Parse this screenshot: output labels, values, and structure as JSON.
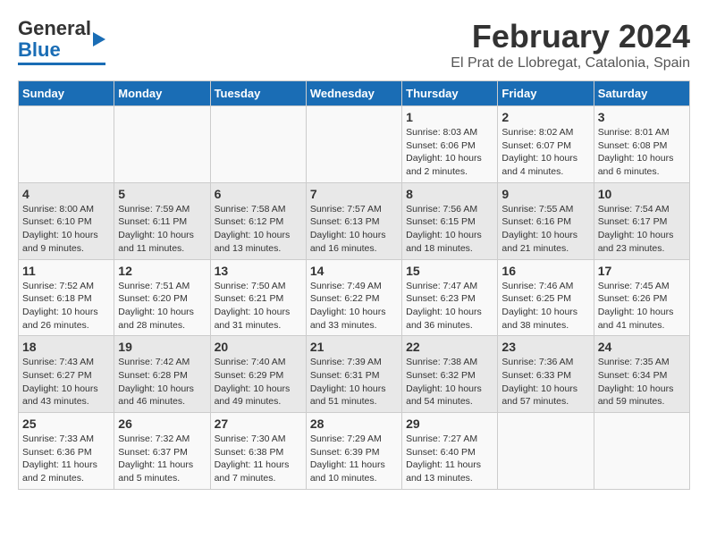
{
  "header": {
    "logo_general": "General",
    "logo_blue": "Blue",
    "title": "February 2024",
    "subtitle": "El Prat de Llobregat, Catalonia, Spain"
  },
  "weekdays": [
    "Sunday",
    "Monday",
    "Tuesday",
    "Wednesday",
    "Thursday",
    "Friday",
    "Saturday"
  ],
  "weeks": [
    [
      {
        "day": "",
        "info": ""
      },
      {
        "day": "",
        "info": ""
      },
      {
        "day": "",
        "info": ""
      },
      {
        "day": "",
        "info": ""
      },
      {
        "day": "1",
        "info": "Sunrise: 8:03 AM\nSunset: 6:06 PM\nDaylight: 10 hours\nand 2 minutes."
      },
      {
        "day": "2",
        "info": "Sunrise: 8:02 AM\nSunset: 6:07 PM\nDaylight: 10 hours\nand 4 minutes."
      },
      {
        "day": "3",
        "info": "Sunrise: 8:01 AM\nSunset: 6:08 PM\nDaylight: 10 hours\nand 6 minutes."
      }
    ],
    [
      {
        "day": "4",
        "info": "Sunrise: 8:00 AM\nSunset: 6:10 PM\nDaylight: 10 hours\nand 9 minutes."
      },
      {
        "day": "5",
        "info": "Sunrise: 7:59 AM\nSunset: 6:11 PM\nDaylight: 10 hours\nand 11 minutes."
      },
      {
        "day": "6",
        "info": "Sunrise: 7:58 AM\nSunset: 6:12 PM\nDaylight: 10 hours\nand 13 minutes."
      },
      {
        "day": "7",
        "info": "Sunrise: 7:57 AM\nSunset: 6:13 PM\nDaylight: 10 hours\nand 16 minutes."
      },
      {
        "day": "8",
        "info": "Sunrise: 7:56 AM\nSunset: 6:15 PM\nDaylight: 10 hours\nand 18 minutes."
      },
      {
        "day": "9",
        "info": "Sunrise: 7:55 AM\nSunset: 6:16 PM\nDaylight: 10 hours\nand 21 minutes."
      },
      {
        "day": "10",
        "info": "Sunrise: 7:54 AM\nSunset: 6:17 PM\nDaylight: 10 hours\nand 23 minutes."
      }
    ],
    [
      {
        "day": "11",
        "info": "Sunrise: 7:52 AM\nSunset: 6:18 PM\nDaylight: 10 hours\nand 26 minutes."
      },
      {
        "day": "12",
        "info": "Sunrise: 7:51 AM\nSunset: 6:20 PM\nDaylight: 10 hours\nand 28 minutes."
      },
      {
        "day": "13",
        "info": "Sunrise: 7:50 AM\nSunset: 6:21 PM\nDaylight: 10 hours\nand 31 minutes."
      },
      {
        "day": "14",
        "info": "Sunrise: 7:49 AM\nSunset: 6:22 PM\nDaylight: 10 hours\nand 33 minutes."
      },
      {
        "day": "15",
        "info": "Sunrise: 7:47 AM\nSunset: 6:23 PM\nDaylight: 10 hours\nand 36 minutes."
      },
      {
        "day": "16",
        "info": "Sunrise: 7:46 AM\nSunset: 6:25 PM\nDaylight: 10 hours\nand 38 minutes."
      },
      {
        "day": "17",
        "info": "Sunrise: 7:45 AM\nSunset: 6:26 PM\nDaylight: 10 hours\nand 41 minutes."
      }
    ],
    [
      {
        "day": "18",
        "info": "Sunrise: 7:43 AM\nSunset: 6:27 PM\nDaylight: 10 hours\nand 43 minutes."
      },
      {
        "day": "19",
        "info": "Sunrise: 7:42 AM\nSunset: 6:28 PM\nDaylight: 10 hours\nand 46 minutes."
      },
      {
        "day": "20",
        "info": "Sunrise: 7:40 AM\nSunset: 6:29 PM\nDaylight: 10 hours\nand 49 minutes."
      },
      {
        "day": "21",
        "info": "Sunrise: 7:39 AM\nSunset: 6:31 PM\nDaylight: 10 hours\nand 51 minutes."
      },
      {
        "day": "22",
        "info": "Sunrise: 7:38 AM\nSunset: 6:32 PM\nDaylight: 10 hours\nand 54 minutes."
      },
      {
        "day": "23",
        "info": "Sunrise: 7:36 AM\nSunset: 6:33 PM\nDaylight: 10 hours\nand 57 minutes."
      },
      {
        "day": "24",
        "info": "Sunrise: 7:35 AM\nSunset: 6:34 PM\nDaylight: 10 hours\nand 59 minutes."
      }
    ],
    [
      {
        "day": "25",
        "info": "Sunrise: 7:33 AM\nSunset: 6:36 PM\nDaylight: 11 hours\nand 2 minutes."
      },
      {
        "day": "26",
        "info": "Sunrise: 7:32 AM\nSunset: 6:37 PM\nDaylight: 11 hours\nand 5 minutes."
      },
      {
        "day": "27",
        "info": "Sunrise: 7:30 AM\nSunset: 6:38 PM\nDaylight: 11 hours\nand 7 minutes."
      },
      {
        "day": "28",
        "info": "Sunrise: 7:29 AM\nSunset: 6:39 PM\nDaylight: 11 hours\nand 10 minutes."
      },
      {
        "day": "29",
        "info": "Sunrise: 7:27 AM\nSunset: 6:40 PM\nDaylight: 11 hours\nand 13 minutes."
      },
      {
        "day": "",
        "info": ""
      },
      {
        "day": "",
        "info": ""
      }
    ]
  ]
}
